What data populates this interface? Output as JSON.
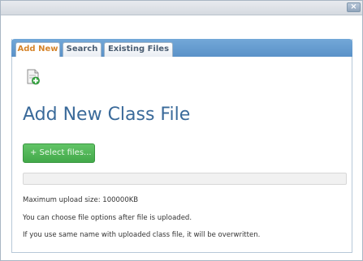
{
  "window": {
    "close_glyph": "×"
  },
  "tabs": [
    {
      "label": "Add New",
      "active": true
    },
    {
      "label": "Search",
      "active": false
    },
    {
      "label": "Existing Files",
      "active": false
    }
  ],
  "main": {
    "icon": "file-add-icon",
    "title": "Add New Class File",
    "select_button_label": "+ Select files...",
    "upload_progress": 0,
    "info_lines": [
      "Maximum upload size: 100000KB",
      "You can choose file options after file is uploaded.",
      "If you use same name with uploaded class file, it will be overwritten."
    ]
  },
  "colors": {
    "tab_bar": "#5a92c8",
    "active_tab_text": "#d6842a",
    "title": "#3a6a9a",
    "select_button": "#4cb552"
  }
}
